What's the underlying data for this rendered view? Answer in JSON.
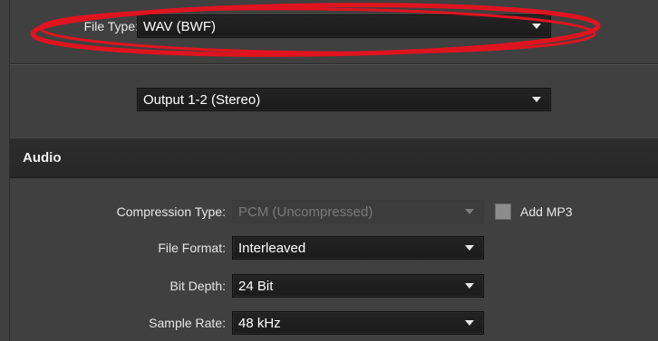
{
  "file_type": {
    "label": "File Type:",
    "value": "WAV (BWF)"
  },
  "output": {
    "value": "Output 1-2 (Stereo)"
  },
  "audio_section": {
    "title": "Audio",
    "compression_type": {
      "label": "Compression Type:",
      "value": "PCM (Uncompressed)",
      "disabled": true
    },
    "add_mp3": {
      "label": "Add MP3",
      "checked": false
    },
    "file_format": {
      "label": "File Format:",
      "value": "Interleaved"
    },
    "bit_depth": {
      "label": "Bit Depth:",
      "value": "24 Bit"
    },
    "sample_rate": {
      "label": "Sample Rate:",
      "value": "48 kHz"
    }
  },
  "colors": {
    "annotation": "#e0141e",
    "panel_bg": "#404040",
    "dropdown_bg": "#1f1f1f"
  },
  "icons": {
    "dropdown": "chevron-down-icon",
    "annotation": "highlight-ellipse"
  }
}
